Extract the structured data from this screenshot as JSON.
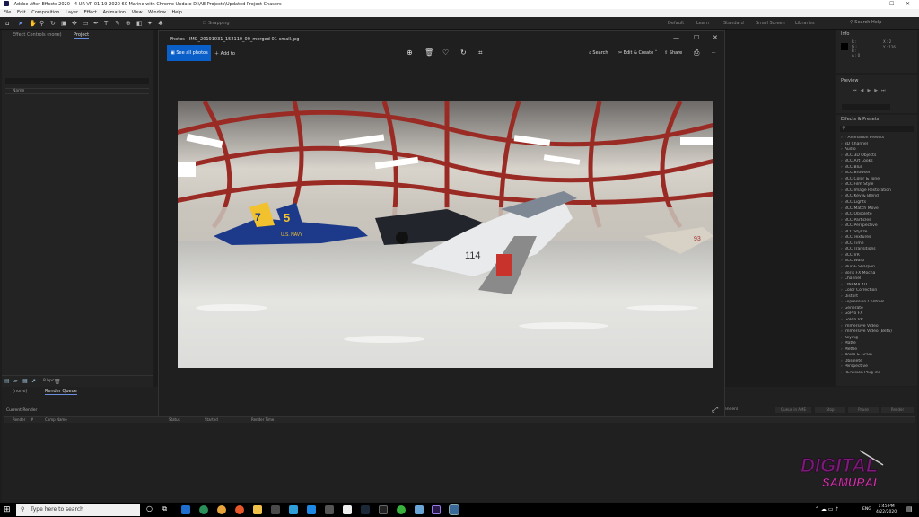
{
  "window": {
    "title": "Adobe After Effects 2020 - 4 UR VR 01-19-2020 60 Marine with Chrome Update D:\\AE Projects\\Updated Project Chasers",
    "minimize": "—",
    "maximize": "☐",
    "close": "✕"
  },
  "menu": [
    "File",
    "Edit",
    "Composition",
    "Layer",
    "Effect",
    "Animation",
    "View",
    "Window",
    "Help"
  ],
  "toolbar": {
    "snapping": "Snapping",
    "workspaces": [
      "Default",
      "Learn",
      "Standard",
      "Small Screen",
      "Libraries"
    ],
    "search_placeholder": "Search Help"
  },
  "left_panel": {
    "tabs": [
      "Effect Controls (none)",
      "Project"
    ],
    "column_name": "Name",
    "footer_bpc": "8 bpc"
  },
  "right_panel": {
    "info_title": "Info",
    "info_rgb": [
      "R :",
      "G :",
      "B :",
      "A : 0"
    ],
    "info_xy": [
      "X : 2",
      "Y : 126"
    ],
    "preview_title": "Preview",
    "effects_title": "Effects & Presets",
    "effects_items": [
      "* Animation Presets",
      "3D Channel",
      "Audio",
      "BCC 3D Objects",
      "BCC Art Looks",
      "BCC Blur",
      "BCC Browser",
      "BCC Color & Tone",
      "BCC Film Style",
      "BCC Image Restoration",
      "BCC Key & Blend",
      "BCC Lights",
      "BCC Match Move",
      "BCC Obsolete",
      "BCC Particles",
      "BCC Perspective",
      "BCC Stylize",
      "BCC Textures",
      "BCC Time",
      "BCC Transitions",
      "BCC VR",
      "BCC Warp",
      "Blur & Sharpen",
      "Boris FX Mocha",
      "Channel",
      "CINEMA 4D",
      "Color Correction",
      "Distort",
      "Expression Controls",
      "Generate",
      "GoPro FX",
      "GoPro VR",
      "Immersive Video",
      "Immersive Video (Beta)",
      "Keying",
      "Matte",
      "Mettle",
      "Noise & Grain",
      "Obsolete",
      "Perspective",
      "RE:Vision Plug-ins"
    ]
  },
  "bottom_panel": {
    "tabs": [
      "(none)",
      "Render Queue"
    ],
    "current_render": "Current Render",
    "columns": [
      "Render",
      "#",
      "Comp Name",
      "Status",
      "Started",
      "Render Time"
    ],
    "right_label": "Renders",
    "buttons": [
      "Queue in AME",
      "Stop",
      "Pause",
      "Render"
    ]
  },
  "photos_app": {
    "title": "Photos - IMG_20191031_152110_00_merged-01-small.jpg",
    "see_all_photos": "See all photos",
    "add_to": "Add to",
    "search": "Search",
    "edit_create": "Edit & Create",
    "share": "Share",
    "more": "···",
    "icons": [
      "zoom-in",
      "delete",
      "favorite",
      "rotate",
      "crop",
      "print",
      "expand"
    ],
    "photo_marks": [
      "7",
      "5",
      "U.S. NAVY",
      "114",
      "93"
    ]
  },
  "taskbar": {
    "search_placeholder": "Type here to search",
    "time": "1:45 PM",
    "date": "4/22/2020",
    "lang": "ENG"
  },
  "watermark": {
    "line1": "DIGITAL",
    "line2": "SAMURAI"
  },
  "colors": {
    "accent": "#0a5fc8",
    "ae_panel": "#232323",
    "taskbar": "#000000"
  }
}
